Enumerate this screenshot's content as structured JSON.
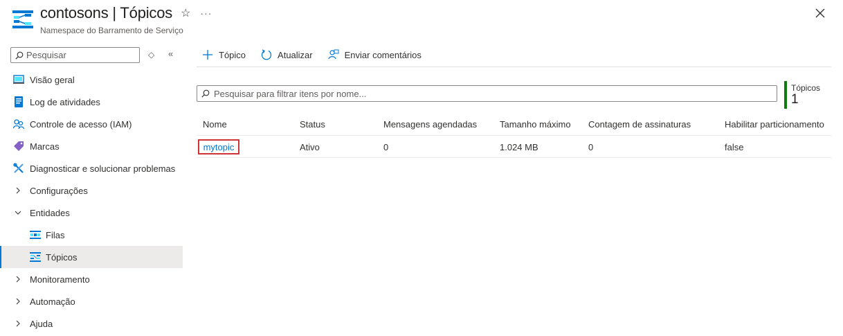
{
  "header": {
    "title": "contosons | Tópicos",
    "subtitle": "Namespace do Barramento de Serviço",
    "more_label": "···"
  },
  "sidebar": {
    "search_placeholder": "Pesquisar",
    "sort_label": "◇",
    "collapse_label": "«",
    "items": [
      {
        "label": "Visão geral",
        "icon": "overview-icon"
      },
      {
        "label": "Log de atividades",
        "icon": "activity-log-icon"
      },
      {
        "label": "Controle de acesso (IAM)",
        "icon": "iam-icon"
      },
      {
        "label": "Marcas",
        "icon": "tag-icon"
      },
      {
        "label": "Diagnosticar e solucionar problemas",
        "icon": "wrench-icon"
      },
      {
        "label": "Configurações",
        "icon": "chevron-right-icon"
      },
      {
        "label": "Entidades",
        "icon": "chevron-down-icon"
      },
      {
        "label": "Filas",
        "icon": "queue-icon"
      },
      {
        "label": "Tópicos",
        "icon": "topic-icon"
      },
      {
        "label": "Monitoramento",
        "icon": "chevron-right-icon"
      },
      {
        "label": "Automação",
        "icon": "chevron-right-icon"
      },
      {
        "label": "Ajuda",
        "icon": "chevron-right-icon"
      }
    ]
  },
  "toolbar": {
    "add_topic": "Tópico",
    "refresh": "Atualizar",
    "feedback": "Enviar comentários"
  },
  "filter": {
    "placeholder": "Pesquisar para filtrar itens por nome..."
  },
  "stat": {
    "label": "Tópicos",
    "value": "1"
  },
  "table": {
    "columns": [
      "Nome",
      "Status",
      "Mensagens agendadas",
      "Tamanho máximo",
      "Contagem de assinaturas",
      "Habilitar particionamento"
    ],
    "rows": [
      [
        "mytopic",
        "Ativo",
        "0",
        "1.024 MB",
        "0",
        "false"
      ]
    ]
  },
  "colors": {
    "accent": "#0078d4",
    "highlight_border": "#d13438",
    "stat_bar": "#107c10"
  }
}
